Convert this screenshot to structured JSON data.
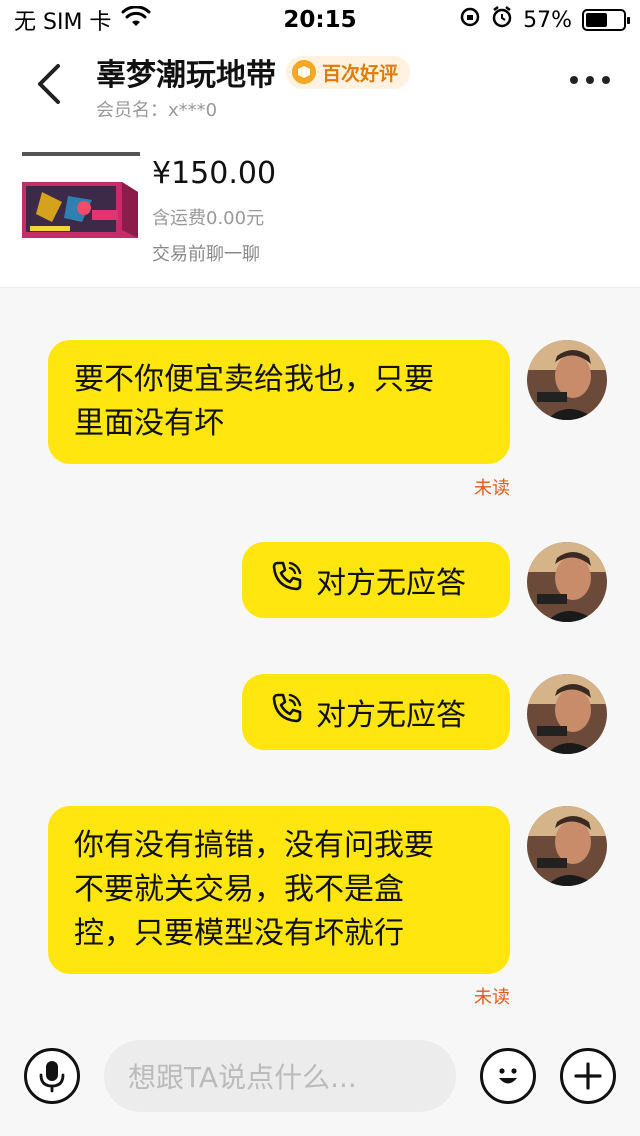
{
  "status": {
    "carrier": "无 SIM 卡",
    "time": "20:15",
    "battery": "57%",
    "battery_level": 0.57
  },
  "header": {
    "title": "辜梦潮玩地带",
    "badge": "百次好评",
    "member": "会员名：x***0"
  },
  "product": {
    "price": "¥150.00",
    "shipping": "含运费0.00元",
    "hint": "交易前聊一聊"
  },
  "messages": [
    {
      "text_line1": "要不你便宜卖给我也，只要",
      "text_line2": "里面没有坏",
      "status": "未读"
    },
    {
      "text": "对方无应答"
    },
    {
      "text": "对方无应答"
    },
    {
      "text_line1": "你有没有搞错，没有问我要",
      "text_line2": "不要就关交易，我不是盒",
      "text_line3": "控，只要模型没有坏就行",
      "status": "未读"
    }
  ],
  "input": {
    "placeholder": "想跟TA说点什么..."
  },
  "colors": {
    "bubble": "#ffe60f",
    "unread": "#e05a1c"
  }
}
